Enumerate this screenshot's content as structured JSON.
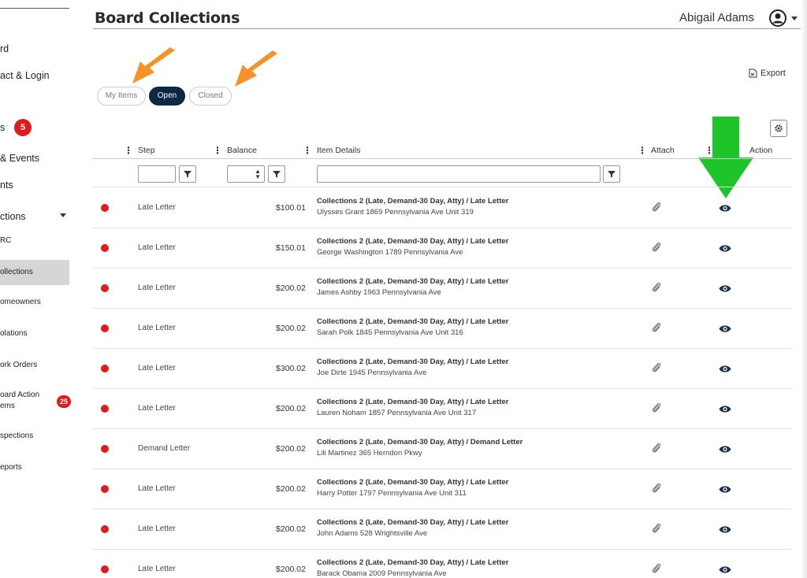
{
  "sidebar": {
    "items": [
      {
        "label": "rd"
      },
      {
        "label": "act & Login"
      },
      {
        "label": "s"
      },
      {
        "label": "& Events"
      },
      {
        "label": "nts"
      },
      {
        "label": "ctions"
      },
      {
        "label": "RC"
      },
      {
        "label": "ollections"
      },
      {
        "label": "omeowners"
      },
      {
        "label": "olations"
      },
      {
        "label": "ork Orders"
      },
      {
        "label": "oard Action"
      },
      {
        "label": "ems"
      },
      {
        "label": "spections"
      },
      {
        "label": "eports"
      }
    ],
    "badge_s": "5",
    "badge_action": "25"
  },
  "header": {
    "title": "Board Collections",
    "user_name": "Abigail Adams"
  },
  "filters": {
    "my_items": "My Items",
    "open": "Open",
    "closed": "Closed"
  },
  "toolbar": {
    "export_label": "Export"
  },
  "table": {
    "columns": {
      "step": "Step",
      "balance": "Balance",
      "item_details": "Item Details",
      "attach": "Attach",
      "action": "Action"
    },
    "rows": [
      {
        "step": "Late Letter",
        "balance": "$100.01",
        "title": "Collections 2 (Late, Demand-30 Day, Atty) / Late Letter",
        "sub": "Ulysses Grant 1869 Pennsylvania Ave Unit 319"
      },
      {
        "step": "Late Letter",
        "balance": "$150.01",
        "title": "Collections 2 (Late, Demand-30 Day, Atty) / Late Letter",
        "sub": "George Washington 1789 Pennsylvania Ave"
      },
      {
        "step": "Late Letter",
        "balance": "$200.02",
        "title": "Collections 2 (Late, Demand-30 Day, Atty) / Late Letter",
        "sub": "James Ashby 1963 Pennsylvania Ave"
      },
      {
        "step": "Late Letter",
        "balance": "$200.02",
        "title": "Collections 2 (Late, Demand-30 Day, Atty) / Late Letter",
        "sub": "Sarah Polk 1845 Pennsylvania Ave Unit 316"
      },
      {
        "step": "Late Letter",
        "balance": "$300.02",
        "title": "Collections 2 (Late, Demand-30 Day, Atty) / Late Letter",
        "sub": "Joe Dirte 1945 Pennsylvania Ave"
      },
      {
        "step": "Late Letter",
        "balance": "$200.02",
        "title": "Collections 2 (Late, Demand-30 Day, Atty) / Late Letter",
        "sub": "Lauren Noham 1857 Pennsylvania Ave Unit 317"
      },
      {
        "step": "Demand Letter",
        "balance": "$200.02",
        "title": "Collections 2 (Late, Demand-30 Day, Atty) / Demand Letter",
        "sub": "Lili Martinez 365 Herndon Pkwy"
      },
      {
        "step": "Late Letter",
        "balance": "$200.02",
        "title": "Collections 2 (Late, Demand-30 Day, Atty) / Late Letter",
        "sub": "Harry Potter 1797 Pennsylvania Ave Unit 311"
      },
      {
        "step": "Late Letter",
        "balance": "$200.02",
        "title": "Collections 2 (Late, Demand-30 Day, Atty) / Late Letter",
        "sub": "John Adams 528 Wrightsville Ave"
      },
      {
        "step": "Late Letter",
        "balance": "$200.02",
        "title": "Collections 2 (Late, Demand-30 Day, Atty) / Late Letter",
        "sub": "Barack Obama 2009 Pennsylvania Ave"
      }
    ]
  },
  "colors": {
    "accent_navy": "#0d2747",
    "status_red": "#e01b1b",
    "arrow_orange": "#f7922a",
    "arrow_green": "#1fc42a"
  },
  "icons": {
    "user": "user-circle-icon",
    "export": "export-file-icon",
    "settings": "gear-icon",
    "filter": "filter-funnel-icon",
    "attach": "paperclip-icon",
    "view": "eye-icon"
  }
}
